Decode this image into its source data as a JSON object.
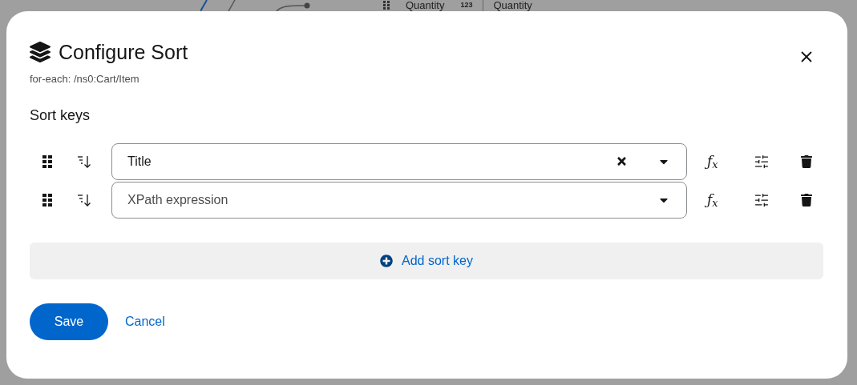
{
  "background": {
    "columns": [
      {
        "label": "Quantity",
        "type_badge": "123"
      },
      {
        "label": "Quantity"
      }
    ]
  },
  "dialog": {
    "title": "Configure Sort",
    "subtitle": "for-each: /ns0:Cart/Item",
    "section_title": "Sort keys",
    "sort_keys": [
      {
        "value": "Title",
        "function_label": "ƒ$_{x}$"
      },
      {
        "placeholder": "XPath expression",
        "function_label": "ƒ$_{x}$"
      }
    ],
    "add_button": "Add sort key",
    "save_button": "Save",
    "cancel_button": "Cancel"
  }
}
